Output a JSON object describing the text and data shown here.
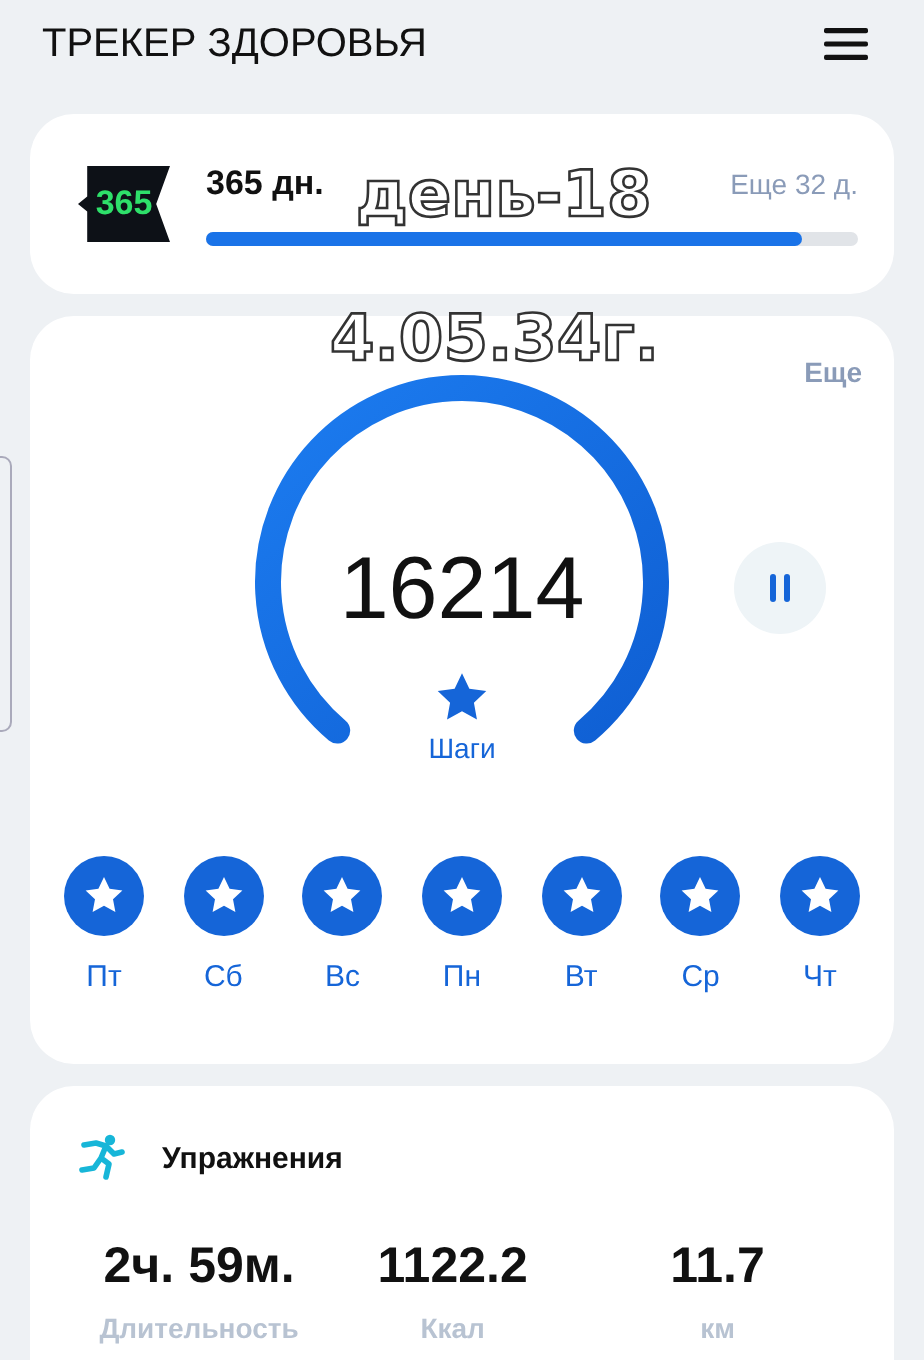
{
  "header": {
    "title": "ТРЕКЕР ЗДОРОВЬЯ"
  },
  "streak": {
    "badge": "365",
    "label": "365 дн.",
    "remaining": "Еще 32 д.",
    "level": 0.915
  },
  "overlay": [
    "день-18",
    "4.05.34г."
  ],
  "steps": {
    "more": "Еще",
    "count": "16214",
    "label": "Шаги"
  },
  "days": [
    {
      "label": "Пт",
      "done": true
    },
    {
      "label": "Сб",
      "done": true
    },
    {
      "label": "Вс",
      "done": true
    },
    {
      "label": "Пн",
      "done": true
    },
    {
      "label": "Вт",
      "done": true
    },
    {
      "label": "Ср",
      "done": true
    },
    {
      "label": "Чт",
      "done": true
    }
  ],
  "exercise": {
    "title": "Упражнения",
    "stats": [
      {
        "value": "2ч. 59м.",
        "label": "Длительность"
      },
      {
        "value": "1122.2",
        "label": "Ккал"
      },
      {
        "value": "11.7",
        "label": "км"
      }
    ]
  }
}
